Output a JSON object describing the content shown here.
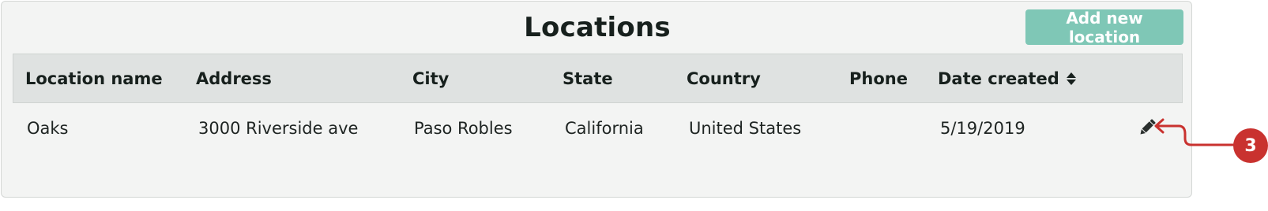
{
  "page": {
    "title": "Locations",
    "add_button_label": "Add new location"
  },
  "table": {
    "columns": [
      {
        "label": "Location name"
      },
      {
        "label": "Address"
      },
      {
        "label": "City"
      },
      {
        "label": "State"
      },
      {
        "label": "Country"
      },
      {
        "label": "Phone"
      },
      {
        "label": "Date created",
        "sortable": true,
        "sort_icon": "sort-icon"
      }
    ],
    "rows": [
      {
        "name": "Oaks",
        "address": "3000 Riverside ave",
        "city": "Paso Robles",
        "state": "California",
        "country": "United States",
        "phone": "",
        "date_created": "5/19/2019",
        "action_icon": "pencil-icon"
      }
    ]
  },
  "annotation": {
    "badge": "3",
    "color": "#c9322f"
  },
  "colors": {
    "button_bg": "#7fc7b6",
    "header_bg": "#dfe2e1",
    "panel_bg": "#f3f4f3"
  }
}
